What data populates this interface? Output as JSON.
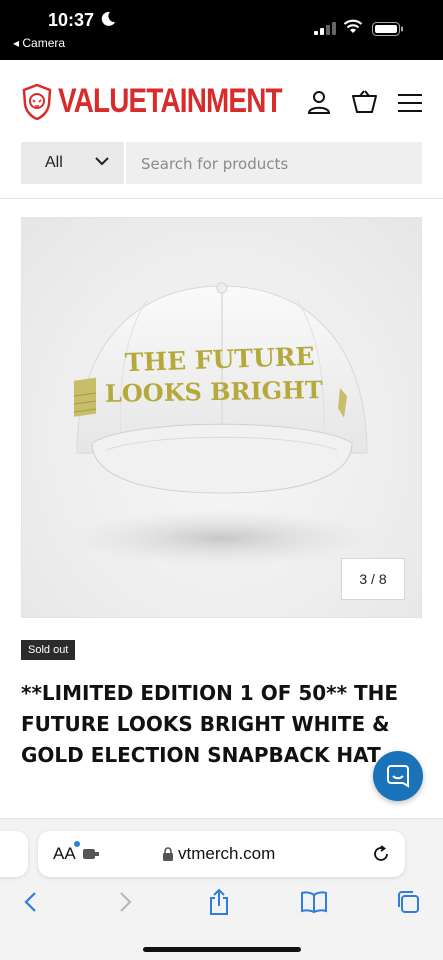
{
  "status_bar": {
    "time": "10:37",
    "back_app": "◂ Camera"
  },
  "header": {
    "brand": "VALUETAINMENT",
    "brand_color": "#d82b2b",
    "icons": [
      "account-icon",
      "cart-icon",
      "menu-icon"
    ]
  },
  "search": {
    "category_selected": "All",
    "placeholder": "Search for products"
  },
  "product": {
    "image_counter": "3 / 8",
    "hat_text_line1": "THE FUTURE",
    "hat_text_line2": "LOOKS BRIGHT",
    "badge": "Sold out",
    "title": "**LIMITED EDITION 1 OF 50** THE FUTURE LOOKS BRIGHT WHITE & GOLD ELECTION SNAPBACK HAT"
  },
  "chat": {
    "icon": "chat-icon",
    "color": "#1a73b8"
  },
  "safari": {
    "aa_label": "AA",
    "url": "vtmerch.com",
    "toolbar_icons": [
      "back-icon",
      "forward-icon",
      "share-icon",
      "bookmarks-icon",
      "tabs-icon"
    ]
  }
}
